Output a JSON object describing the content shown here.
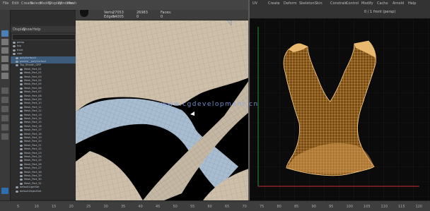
{
  "app": {
    "menu_top": [
      "File",
      "Edit",
      "Create",
      "Select",
      "Modify",
      "Display",
      "Windows",
      "Mesh"
    ],
    "menu_right": [
      "UV",
      "Create",
      "Deform",
      "Skeleton",
      "Skin",
      "Constrain",
      "Control",
      "Modify",
      "Cache",
      "Arnold",
      "Help"
    ]
  },
  "outliner": {
    "menu": [
      "Display",
      "Show",
      "Help"
    ],
    "search_placeholder": "",
    "items": [
      "persp",
      "top",
      "front",
      "side",
      "polySurface1",
      "pasted__polySurface",
      "Top_Sheath_GRP",
      "Mesh_Part_01",
      "Mesh_Part_02",
      "Mesh_Part_03",
      "Mesh_Part_04",
      "Mesh_Part_05",
      "Mesh_Part_06",
      "Mesh_Part_07",
      "Mesh_Part_08",
      "Mesh_Part_09",
      "Mesh_Part_10",
      "Mesh_Part_11",
      "Mesh_Part_12",
      "Mesh_Part_13",
      "Mesh_Part_14",
      "Mesh_Part_15",
      "Mesh_Part_16",
      "Mesh_Part_17",
      "Mesh_Part_18",
      "Mesh_Part_19",
      "Mesh_Part_20",
      "Mesh_Part_21",
      "Mesh_Part_22",
      "Mesh_Part_23",
      "Mesh_Part_24",
      "Mesh_Part_25",
      "Mesh_Part_26",
      "Mesh_Part_27",
      "Mesh_Part_28",
      "Mesh_Part_29",
      "Mesh_Part_30",
      "Mesh_Part_31",
      "defaultLightSet",
      "defaultObjectSet"
    ]
  },
  "viewport_left": {
    "hud": [
      "Verts:",
      "Edges:",
      "Faces:"
    ],
    "hud_values": [
      "27053",
      "54005",
      "26983"
    ],
    "hud_values2": [
      "0",
      "0",
      "0"
    ]
  },
  "viewport_right": {
    "camera_label": "front",
    "status_text": "0 / 1  front (persp)"
  },
  "timeline": {
    "ticks": [
      "5",
      "10",
      "15",
      "20",
      "25",
      "30",
      "35",
      "40",
      "45",
      "50",
      "55",
      "60",
      "65",
      "70",
      "75",
      "80",
      "85",
      "90",
      "95",
      "100",
      "105",
      "110",
      "115",
      "120"
    ]
  },
  "watermark": "www.cgdevelopment.cn",
  "colors": {
    "mesh_wire": "#ffc86b",
    "mesh_fill": "#e2a766",
    "skin": "#cdbfa9",
    "grid_red": "#c03030",
    "grid_green": "#2f8f2f",
    "selection_blue": "#4b7fb5"
  }
}
